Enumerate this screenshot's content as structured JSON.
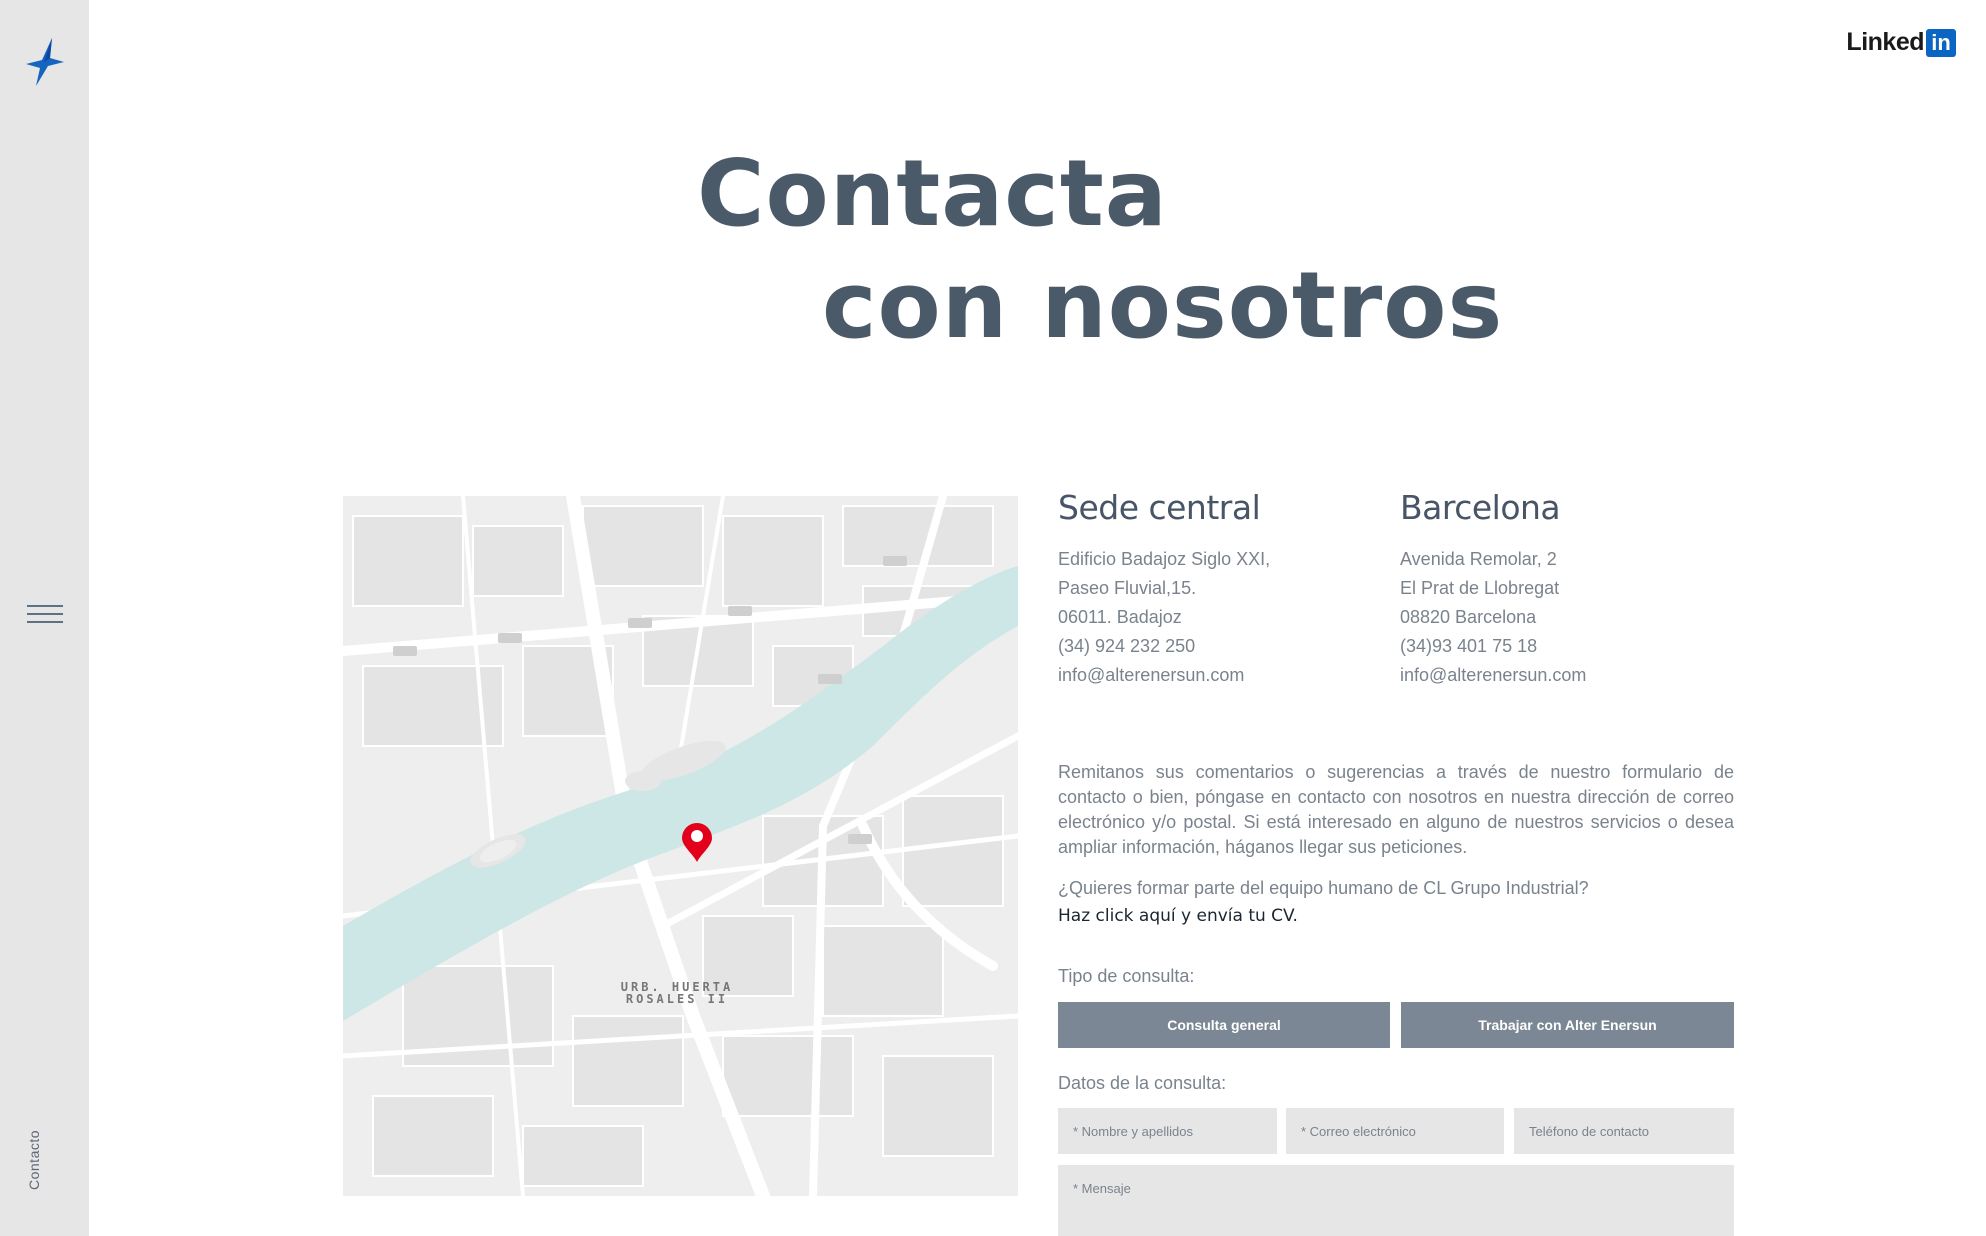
{
  "brand": {
    "accent": "#0a66c2",
    "text_dark": "#4b5a69",
    "button_bg": "#7b8794"
  },
  "sidebar": {
    "label": "Contacto",
    "logo_icon": "bolt-star-icon",
    "menu_icon": "hamburger-icon"
  },
  "header": {
    "linkedin_word": "Linked",
    "linkedin_box": "in"
  },
  "headline": {
    "line1": "Contacta",
    "line2": "con nosotros"
  },
  "map": {
    "area_label_1": "URB. HUERTA",
    "area_label_2": "ROSALES II",
    "marker_icon": "map-pin-icon"
  },
  "offices": [
    {
      "title": "Sede central",
      "lines": [
        "Edificio Badajoz Siglo XXI,",
        "Paseo Fluvial,15.",
        "06011. Badajoz",
        "(34) 924 232 250",
        "info@alterenersun.com"
      ]
    },
    {
      "title": "Barcelona",
      "lines": [
        "Avenida Remolar, 2",
        "El Prat de Llobregat",
        "08820 Barcelona",
        "(34)93 401 75 18",
        "info@alterenersun.com"
      ]
    }
  ],
  "intro": "Remitanos sus comentarios o sugerencias a través de nuestro formulario de contacto o bien, póngase en contacto con nosotros en nuestra dirección de correo electrónico y/o postal. Si está interesado en alguno de nuestros servicios o desea ampliar información, háganos llegar sus peticiones.",
  "cv": {
    "question": "¿Quieres formar parte del equipo humano de CL Grupo Industrial?",
    "link": "Haz click aquí y envía tu CV."
  },
  "form": {
    "tipo_label": "Tipo de consulta:",
    "buttons": [
      "Consulta general",
      "Trabajar con Alter Enersun"
    ],
    "datos_label": "Datos de la consulta:",
    "fields": [
      "* Nombre y apellidos",
      "* Correo electrónico",
      "Teléfono de contacto"
    ],
    "message_placeholder": "* Mensaje"
  }
}
